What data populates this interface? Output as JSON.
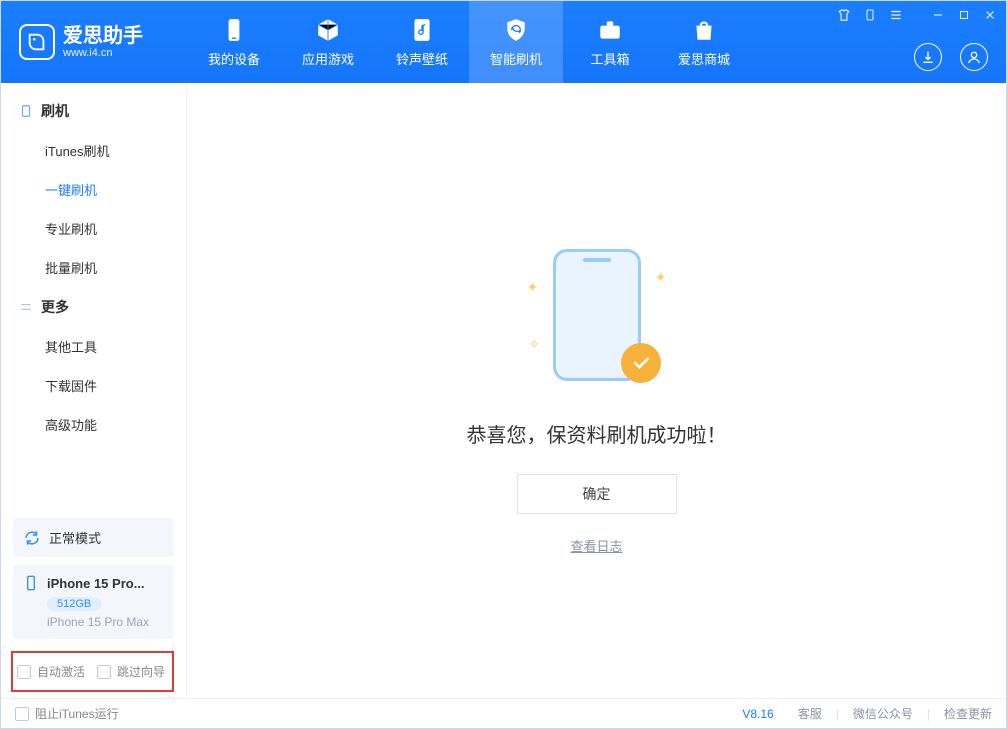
{
  "app": {
    "name_cn": "爱思助手",
    "url": "www.i4.cn"
  },
  "nav": [
    {
      "id": "device",
      "label": "我的设备"
    },
    {
      "id": "apps",
      "label": "应用游戏"
    },
    {
      "id": "ringtone",
      "label": "铃声壁纸"
    },
    {
      "id": "flash",
      "label": "智能刷机"
    },
    {
      "id": "toolbox",
      "label": "工具箱"
    },
    {
      "id": "store",
      "label": "爱思商城"
    }
  ],
  "nav_active": 3,
  "sidebar": {
    "groups": [
      {
        "title": "刷机",
        "icon": "tablet-icon",
        "items": [
          "iTunes刷机",
          "一键刷机",
          "专业刷机",
          "批量刷机"
        ],
        "active_idx": 1
      },
      {
        "title": "更多",
        "icon": "more-icon",
        "items": [
          "其他工具",
          "下载固件",
          "高级功能"
        ],
        "active_idx": -1
      }
    ]
  },
  "status": {
    "mode_label": "正常模式"
  },
  "device": {
    "name_short": "iPhone 15 Pro...",
    "capacity": "512GB",
    "model": "iPhone 15 Pro Max"
  },
  "checkboxes": {
    "auto_activate": "自动激活",
    "skip_wizard": "跳过向导"
  },
  "main": {
    "success_msg": "恭喜您，保资料刷机成功啦！",
    "ok_label": "确定",
    "view_log": "查看日志"
  },
  "footer": {
    "block_itunes": "阻止iTunes运行",
    "version": "V8.16",
    "links": [
      "客服",
      "微信公众号",
      "检查更新"
    ]
  }
}
